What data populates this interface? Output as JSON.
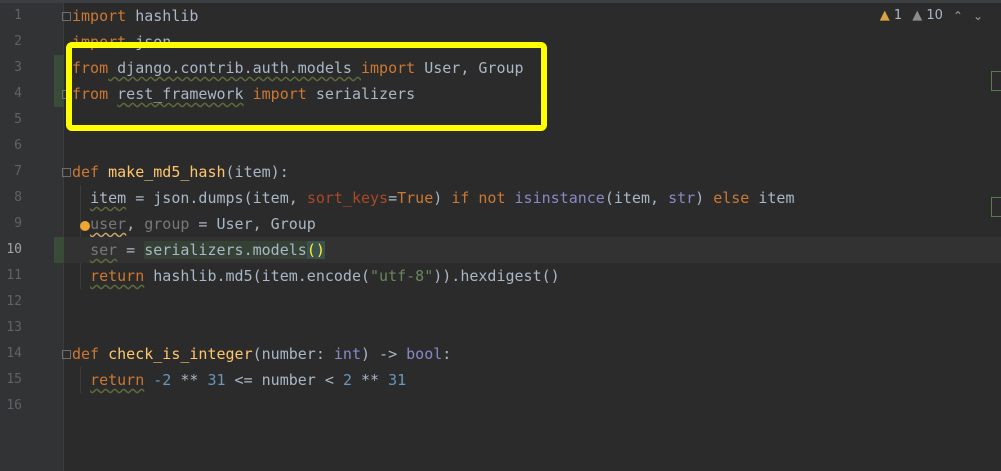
{
  "editor": {
    "line_numbers": [
      "1",
      "2",
      "3",
      "4",
      "5",
      "6",
      "7",
      "8",
      "9",
      "10",
      "11",
      "12",
      "13",
      "14",
      "15",
      "16"
    ],
    "current_line": 10,
    "inspections": {
      "warnings": "1",
      "weak_warnings": "10"
    }
  },
  "code": {
    "l1": {
      "kw": "import",
      "rest": " hashlib"
    },
    "l2": {
      "kw": "import",
      "rest": " json"
    },
    "l3": {
      "kw1": "from",
      "mod": " django.contrib.auth.models ",
      "kw2": "import",
      "rest": " User, Group"
    },
    "l4": {
      "kw1": "from",
      "mod": "rest_framework",
      "kw2": "import",
      "rest": " serializers"
    },
    "l7": {
      "kw": "def",
      "name": "make_md5_hash",
      "rest": "(item):"
    },
    "l8": {
      "var": "item",
      "a": " = json.dumps(item, ",
      "param": "sort_keys",
      "eq": "=",
      "true": "True",
      "b": ") ",
      "if": "if not",
      "sp": " ",
      "isinst": "isinstance",
      "c": "(item, ",
      "str": "str",
      "d": ") ",
      "else": "else",
      "e": " item"
    },
    "l9": {
      "user": "user",
      "comma": ", ",
      "group": "group",
      "rest": " = User, Group"
    },
    "l10": {
      "ser": "ser",
      "eq": " = ",
      "call": "serializers.models",
      "paren": "()"
    },
    "l11": {
      "kw": "return",
      "a": " hashlib.md5(item.encode(",
      "str": "\"utf-8\"",
      "b": ")).hexdigest()"
    },
    "l14": {
      "kw": "def",
      "name": "check_is_integer",
      "a": "(number: ",
      "int": "int",
      "b": ") -> ",
      "bool": "bool",
      "c": ":"
    },
    "l15": {
      "kw": "return",
      "a": " ",
      "n1": "-2",
      "b": " ** ",
      "n2": "31",
      "c": " <= number < ",
      "n3": "2",
      "d": " ** ",
      "n4": "31"
    }
  },
  "colors": {
    "highlight_box": "#ffff00",
    "background": "#2b2b2b",
    "keyword": "#cc7832",
    "function": "#ffc66d"
  }
}
